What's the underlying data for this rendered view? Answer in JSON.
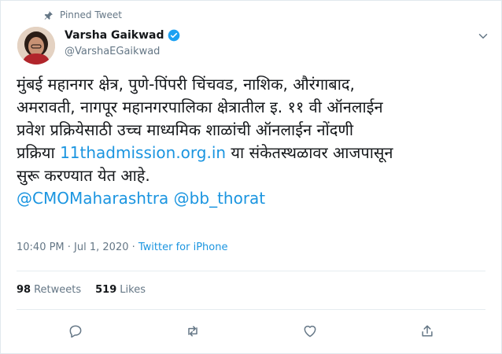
{
  "pinned_label": "Pinned Tweet",
  "author": {
    "name": "Varsha Gaikwad",
    "handle": "@VarshaEGaikwad"
  },
  "tweet": {
    "line1": "मुंबई महानगर क्षेत्र, पुणे-पिंपरी चिंचवड, नाशिक, औरंगाबाद,",
    "line2": "अमरावती, नागपूर महानगरपालिका क्षेत्रातील इ. ११ वी ऑनलाईन",
    "line3": "प्रवेश प्रक्रियेसाठी उच्च माध्यमिक शाळांची ऑनलाईन नोंदणी",
    "line4_pre": "प्रक्रिया ",
    "link": "11thadmission.org.in",
    "line4_post": " या संकेतस्थळावर आजपासून",
    "line5": "सुरू करण्यात येत आहे.",
    "mention1": "@CMOMaharashtra",
    "mention2": "@bb_thorat"
  },
  "meta": {
    "time": "10:40 PM · Jul 1, 2020 · ",
    "source": "Twitter for iPhone"
  },
  "stats": {
    "retweets_count": "98",
    "retweets_label": "Retweets",
    "likes_count": "519",
    "likes_label": "Likes"
  },
  "icons": {
    "pin": "pin-icon",
    "verified": "verified-badge-icon",
    "caret": "chevron-down-icon",
    "reply": "reply-icon",
    "retweet": "retweet-icon",
    "like": "heart-icon",
    "share": "share-icon"
  },
  "colors": {
    "link": "#1b95e0",
    "muted": "#657786",
    "text": "#14171a"
  }
}
